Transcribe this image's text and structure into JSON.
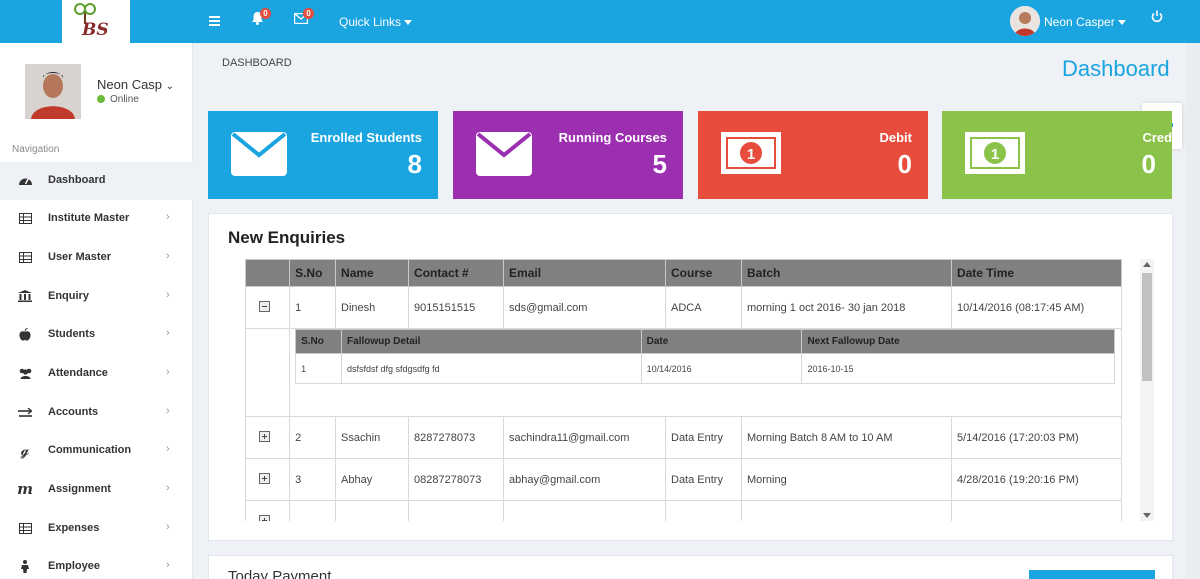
{
  "app": {
    "logo_text": "BS"
  },
  "topbar": {
    "notifications_count": "0",
    "messages_count": "0",
    "quick_links": "Quick Links",
    "user_name": "Neon Casper"
  },
  "sidebar": {
    "profile_name": "Neon Casp",
    "status": "Online",
    "nav_header": "Navigation",
    "items": [
      {
        "label": "Dashboard",
        "icon": "dashboard-icon"
      },
      {
        "label": "Institute Master",
        "icon": "table-icon"
      },
      {
        "label": "User Master",
        "icon": "table-icon"
      },
      {
        "label": "Enquiry",
        "icon": "bank-icon"
      },
      {
        "label": "Students",
        "icon": "apple-icon"
      },
      {
        "label": "Attendance",
        "icon": "users-icon"
      },
      {
        "label": "Accounts",
        "icon": "exchange-icon"
      },
      {
        "label": "Communication",
        "icon": "google-icon"
      },
      {
        "label": "Assignment",
        "icon": "m-icon"
      },
      {
        "label": "Expenses",
        "icon": "table-icon"
      },
      {
        "label": "Employee",
        "icon": "person-icon"
      }
    ]
  },
  "header": {
    "breadcrumb": "DASHBOARD",
    "title": "Dashboard"
  },
  "stats": [
    {
      "label": "Enrolled Students",
      "value": "8",
      "color": "#1aa4e0",
      "icon": "envelope-icon"
    },
    {
      "label": "Running Courses",
      "value": "5",
      "color": "#9b2fb0",
      "icon": "envelope-icon"
    },
    {
      "label": "Debit",
      "value": "0",
      "color": "#e74c3c",
      "icon": "money-icon"
    },
    {
      "label": "Credit",
      "value": "0",
      "color": "#8bc34a",
      "icon": "money-icon"
    }
  ],
  "enquiries": {
    "title": "New Enquiries",
    "columns": [
      "S.No",
      "Name",
      "Contact #",
      "Email",
      "Course",
      "Batch",
      "Date Time"
    ],
    "rows": [
      {
        "sno": "1",
        "name": "Dinesh",
        "contact": "9015151515",
        "email": "sds@gmail.com",
        "course": "ADCA",
        "batch": "morning 1 oct 2016- 30 jan 2018",
        "datetime": "10/14/2016 (08:17:45 AM)"
      },
      {
        "sno": "2",
        "name": "Ssachin",
        "contact": "8287278073",
        "email": "sachindra11@gmail.com",
        "course": "Data Entry",
        "batch": "Morning Batch 8 AM to 10 AM",
        "datetime": "5/14/2016 (17:20:03 PM)"
      },
      {
        "sno": "3",
        "name": "Abhay",
        "contact": "08287278073",
        "email": "abhay@gmail.com",
        "course": "Data Entry",
        "batch": "Morning",
        "datetime": "4/28/2016 (19:20:16 PM)"
      }
    ],
    "followup": {
      "columns": [
        "S.No",
        "Fallowup Detail",
        "Date",
        "Next Fallowup Date"
      ],
      "rows": [
        {
          "sno": "1",
          "detail": "dsfsfdsf dfg sfdgsdfg fd",
          "date": "10/14/2016",
          "next": "2016-10-15"
        }
      ]
    }
  },
  "today_payment": {
    "title": "Today Payment"
  }
}
